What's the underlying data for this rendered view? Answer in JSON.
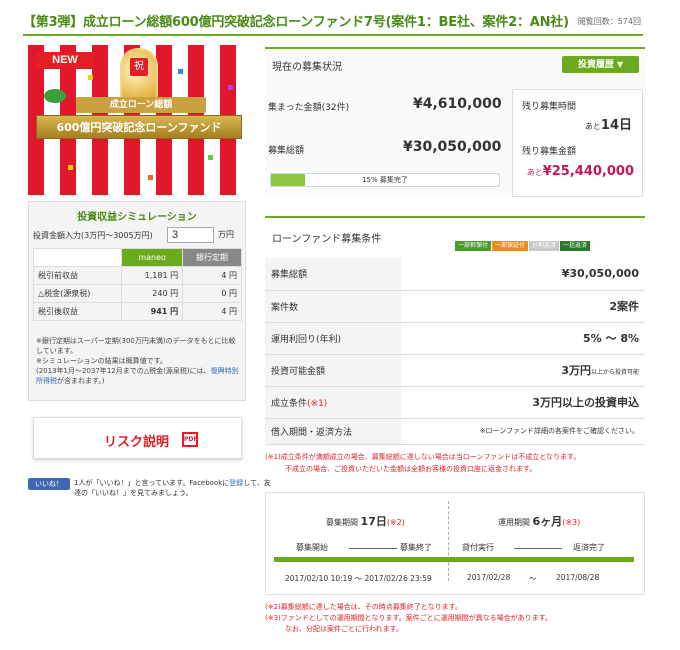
{
  "header": {
    "title": "【第3弾】成立ローン総額600億円突破記念ローンファンド7号(案件1：BE社、案件2：AN社)",
    "views": "閲覧回数：574回"
  },
  "banner": {
    "new_label": "NEW",
    "iwai": "祝",
    "sub": "成立ローン総額",
    "main": "600億円突破記念ローンファンド"
  },
  "simulation": {
    "title": "投資収益シミュレーション",
    "amount_label": "投資金額入力(3万円～3005万円)",
    "amount_value": "3",
    "amount_unit": "万円",
    "col_a": "maneo",
    "col_b": "銀行定期",
    "rows": [
      {
        "label": "税引前収益",
        "a": "1,181 円",
        "b": "4 円"
      },
      {
        "label": "△税金(源泉税)",
        "a": "240 円",
        "b": "0 円"
      },
      {
        "label": "税引後収益",
        "a": "941 円",
        "b": "4 円"
      }
    ],
    "note1": "※銀行定期はスーパー定期(300万円未満)のデータをもとに比較しています。",
    "note2": "※シミュレーションの結果は概算値です。",
    "note3_a": "(2013年1月～2037年12月までの△税金(源泉税)には、",
    "note3_link": "復興特別所得税",
    "note3_b": "が含まれます。)"
  },
  "risk": {
    "label": "リスク説明",
    "icon_text": "PDF"
  },
  "facebook": {
    "button": "いいね！",
    "text_a": "1人が「いいね！」と言っています。Facebookに",
    "text_link": "登録",
    "text_b": "して、友達の「いいね！」を見てみましょう。"
  },
  "status": {
    "title": "現在の募集状況",
    "history_button": "投資履歴",
    "raised_label": "集まった金額(32件)",
    "raised_value": "¥4,610,000",
    "total_label": "募集総額",
    "total_value": "¥30,050,000",
    "progress_percent": 15,
    "progress_text": "15% 募集完了",
    "remain_time_label": "残り募集時間",
    "remain_time_prefix": "あと",
    "remain_time_value": "14日",
    "remain_amount_label": "残り募集金額",
    "remain_amount_prefix": "あと",
    "remain_amount_value": "¥25,440,000"
  },
  "conditions": {
    "title": "ローンファンド募集条件",
    "tags": [
      {
        "label": "一部担保付",
        "color": "#4a9a2a"
      },
      {
        "label": "一部保証付",
        "color": "#f08a1c"
      },
      {
        "label": "分割返済",
        "color": "#c8c8c8"
      },
      {
        "label": "一括返済",
        "color": "#2a7a2a"
      }
    ],
    "rows": [
      {
        "k": "募集総額",
        "v": "¥30,050,000"
      },
      {
        "k": "案件数",
        "v": "2案件"
      },
      {
        "k": "運用利回り(年利)",
        "v": "5% ～ 8%"
      },
      {
        "k": "投資可能金額",
        "v": "3万円",
        "v_small": "以上から投資可能"
      },
      {
        "k": "成立条件",
        "k_mark": "(※1)",
        "v": "3万円以上の投資申込"
      },
      {
        "k": "借入期間・返済方法",
        "v_note": "※ローンファンド詳細の各案件をご確認ください。"
      }
    ],
    "note_a": "(※1)成立条件が満額成立の場合、募集総額に達しない場合は当ローンファンドは不成立となります。",
    "note_b": "不成立の場合、ご投資いただいた金額は全額お客様の投資口座に返金されます。"
  },
  "timeline": {
    "period_label": "募集期間",
    "period_value": "17日",
    "period_mark": "(※2)",
    "op_label": "運用期間",
    "op_value": "6ヶ月",
    "op_mark": "(※3)",
    "start": "募集開始",
    "end": "募集終了",
    "exec": "貸付実行",
    "repay": "返済完了",
    "date1": "2017/02/10 10:19 ～ 2017/02/26 23:59",
    "date2": "2017/02/28",
    "tilde": "～",
    "date3": "2017/08/28"
  },
  "footnotes": {
    "n2": "(※2)募集総額に達した場合は、その時点募集終了となります。",
    "n3": "(※3)ファンドとしての運用期間となります。案件ごとに運用期間が異なる場合があります。",
    "n3b": "なお、分配は案件ごとに行われます。"
  }
}
